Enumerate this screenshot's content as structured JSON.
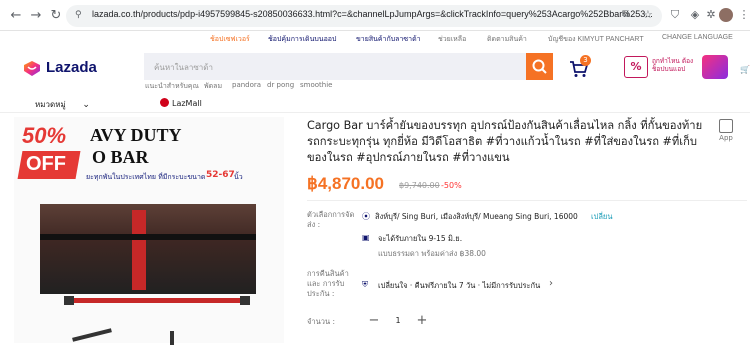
{
  "browser": {
    "url": "lazada.co.th/products/pdp-i4957599845-s20850036633.html?c=&channelLpJumpArgs=&clickTrackInfo=query%253Acargo%252Bbar%253..."
  },
  "toplinks": {
    "save_more": "ช้อปเซฟเวอร์",
    "sell": "ช้อปคุ้มการเดินบนออป",
    "sell_on_lazada": "ขายสินค้ากับลาซาด้า",
    "help": "ช่วยเหลือ",
    "track_order": "ติดตามสินค้า",
    "account": "บัญชีของ KIMYUT PANCHART",
    "language": "CHANGE LANGUAGE"
  },
  "header": {
    "logo": "Lazada",
    "search_placeholder": "ค้นหาในลาซาด้า",
    "cart_count": "3",
    "suggestions": [
      "แนะนำสำหรับคุณ",
      "พัดลม",
      "pandora",
      "dr pong",
      "smoothie"
    ],
    "categories": "หมวดหมู่",
    "lazmall": "LazMall",
    "promo": "ถูกทำไหน ต้อง ช็อปบนแอป"
  },
  "product": {
    "title": "Cargo Bar บาร์ค้ำยันของบรรทุก อุปกรณ์ป้องกันสินค้าเลื่อนไหล กลิ้ง ที่กั้นของท้ายรถกระบะทุกรุ่น ทุกยี่ห้อ มีวิดีโอสาธิต #ที่วางแก้วน้ำในรถ #ที่ใส่ของในรถ #ที่เก็บของในรถ #อุปกรณ์ภายในรถ #ที่วางแขน",
    "app_label": "App",
    "price": "฿4,870.00",
    "old_price": "฿9,740.00",
    "discount": "-50%",
    "image_banner": {
      "heavy_duty": "AVY DUTY",
      "cargo_bar": "O BAR",
      "percent": "50%",
      "off": "OFF",
      "caption": "ยะทุกพันในประเทศไทย ที่มีกระบะขนาด",
      "size": "52-67",
      "unit": "นิ้ว"
    },
    "delivery": {
      "label": "ตัวเลือกการจัดส่ง :",
      "location": "สิงห์บุรี/ Sing Buri, เมืองสิงห์บุรี/ Mueang Sing Buri, 16000",
      "change": "เปลี่ยน",
      "eta": "จะได้รับภายใน 9-15 มิ.ย.",
      "standard": "แบบธรรมดา พร้อมค่าส่ง ฿38.00"
    },
    "returns": {
      "label": "การคืนสินค้าและ การรับประกัน :",
      "text": "เปลี่ยนใจ · คืนฟรีภายใน 7 วัน · ไม่มีการรับประกัน"
    },
    "quantity": {
      "label": "จำนวน :",
      "value": "1"
    }
  },
  "colors": {
    "accent": "#f57224",
    "navy": "#0f146d",
    "lazmall_red": "#d0021b"
  }
}
